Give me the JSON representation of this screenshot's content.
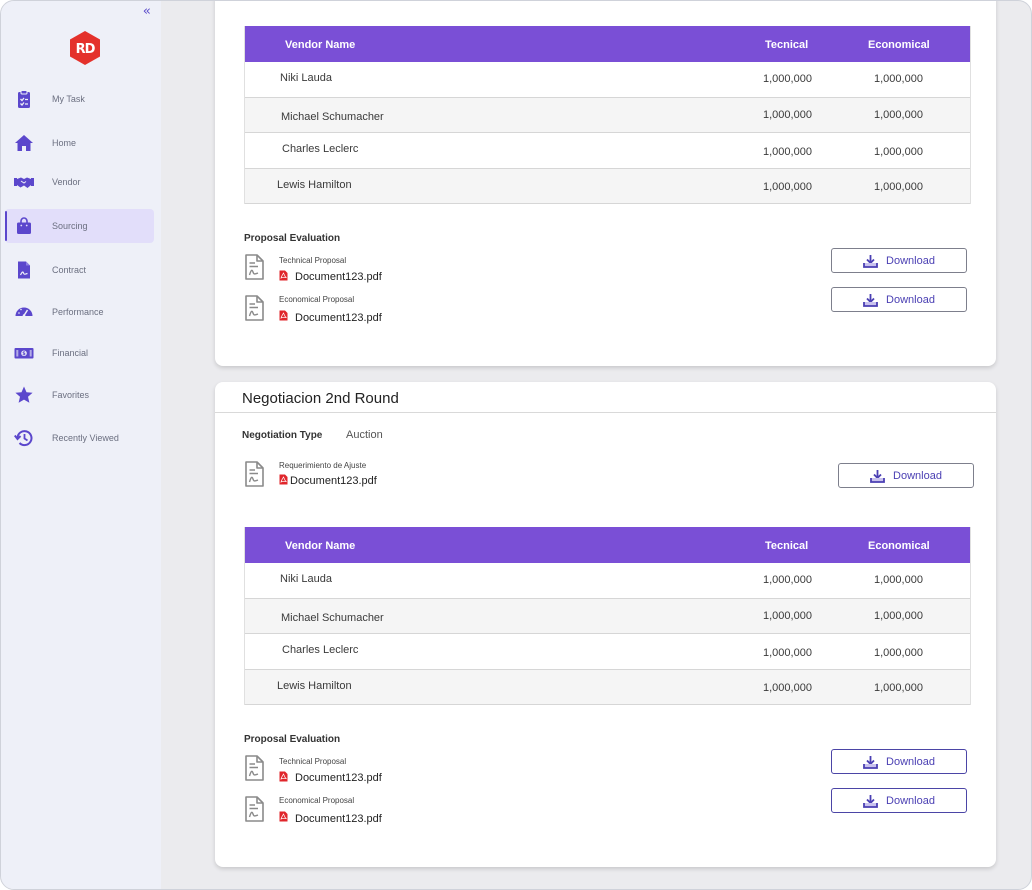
{
  "sidebar": {
    "collapse_glyph": "«",
    "logo_text": "RD",
    "items": [
      {
        "label": "My Task",
        "icon": "clipboard-icon"
      },
      {
        "label": "Home",
        "icon": "home-icon"
      },
      {
        "label": "Vendor",
        "icon": "handshake-icon"
      },
      {
        "label": "Sourcing",
        "icon": "shopping-bag-icon",
        "active": true
      },
      {
        "label": "Contract",
        "icon": "contract-icon"
      },
      {
        "label": "Performance",
        "icon": "gauge-icon"
      },
      {
        "label": "Financial",
        "icon": "money-icon"
      },
      {
        "label": "Favorites",
        "icon": "star-icon"
      },
      {
        "label": "Recently Viewed",
        "icon": "history-icon"
      }
    ]
  },
  "colors": {
    "accent": "#7a4fd6",
    "brand_red": "#e4312b",
    "sidebar_bg": "#eef0f8"
  },
  "round1": {
    "table": {
      "headers": {
        "vendor": "Vendor Name",
        "tecnical": "Tecnical",
        "economical": "Economical"
      },
      "rows": [
        {
          "vendor": "Niki Lauda",
          "tecnical": "1,000,000",
          "economical": "1,000,000"
        },
        {
          "vendor": "Michael Schumacher",
          "tecnical": "1,000,000",
          "economical": "1,000,000"
        },
        {
          "vendor": "Charles Leclerc",
          "tecnical": "1,000,000",
          "economical": "1,000,000"
        },
        {
          "vendor": "Lewis Hamilton",
          "tecnical": "1,000,000",
          "economical": "1,000,000"
        }
      ]
    },
    "evaluation": {
      "title": "Proposal Evaluation",
      "docs": [
        {
          "label": "Technical Proposal",
          "file": "Document123.pdf",
          "button": "Download"
        },
        {
          "label": "Economical Proposal",
          "file": "Document123.pdf",
          "button": "Download"
        }
      ]
    }
  },
  "round2": {
    "title": "Negotiacion 2nd Round",
    "negotiation_type_label": "Negotiation Type",
    "negotiation_type_value": "Auction",
    "adjustment": {
      "label": "Requerimiento de Ajuste",
      "file": "Document123.pdf",
      "button": "Download"
    },
    "table": {
      "headers": {
        "vendor": "Vendor Name",
        "tecnical": "Tecnical",
        "economical": "Economical"
      },
      "rows": [
        {
          "vendor": "Niki Lauda",
          "tecnical": "1,000,000",
          "economical": "1,000,000"
        },
        {
          "vendor": "Michael Schumacher",
          "tecnical": "1,000,000",
          "economical": "1,000,000"
        },
        {
          "vendor": "Charles Leclerc",
          "tecnical": "1,000,000",
          "economical": "1,000,000"
        },
        {
          "vendor": "Lewis Hamilton",
          "tecnical": "1,000,000",
          "economical": "1,000,000"
        }
      ]
    },
    "evaluation": {
      "title": "Proposal Evaluation",
      "docs": [
        {
          "label": "Technical Proposal",
          "file": "Document123.pdf",
          "button": "Download"
        },
        {
          "label": "Economical Proposal",
          "file": "Document123.pdf",
          "button": "Download"
        }
      ]
    }
  }
}
